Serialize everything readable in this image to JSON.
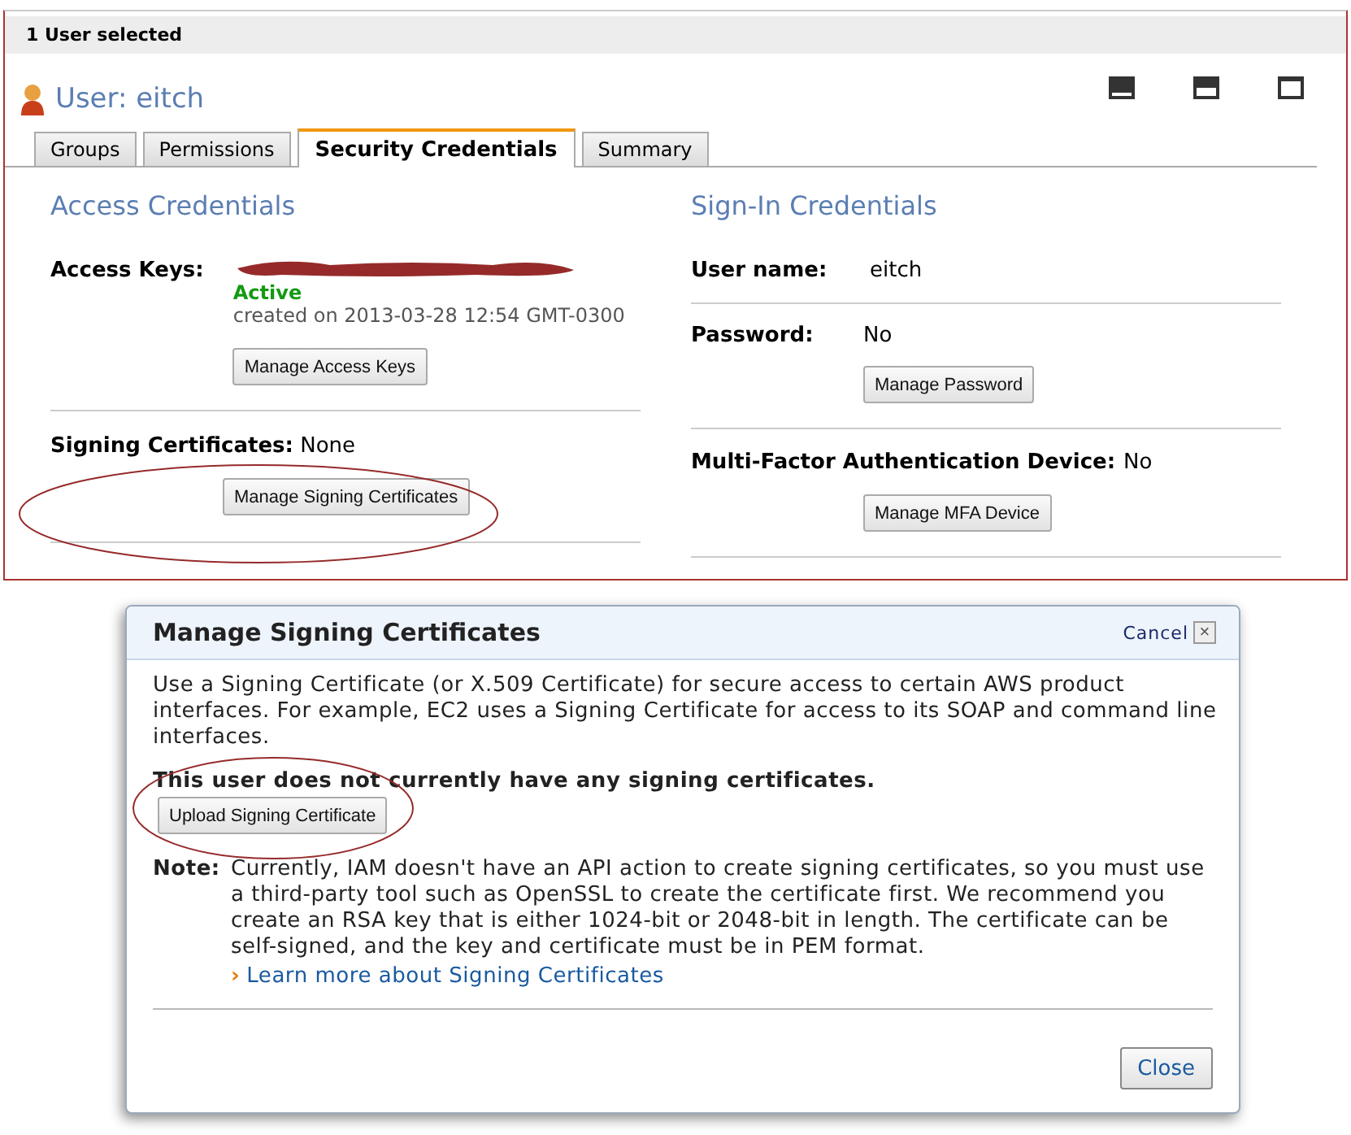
{
  "selection_bar": {
    "text": "1 User selected"
  },
  "user": {
    "label": "User:",
    "name": "eitch"
  },
  "tabs": [
    {
      "label": "Groups",
      "selected": false
    },
    {
      "label": "Permissions",
      "selected": false
    },
    {
      "label": "Security Credentials",
      "selected": true
    },
    {
      "label": "Summary",
      "selected": false
    }
  ],
  "access_credentials": {
    "title": "Access Credentials",
    "access_keys": {
      "label": "Access Keys:",
      "status": "Active",
      "created": "created on 2013-03-28 12:54 GMT-0300",
      "button": "Manage Access Keys"
    },
    "signing_certificates": {
      "label": "Signing Certificates:",
      "value": "None",
      "button": "Manage Signing Certificates"
    }
  },
  "sign_in_credentials": {
    "title": "Sign-In Credentials",
    "user_name": {
      "label": "User name:",
      "value": "eitch"
    },
    "password": {
      "label": "Password:",
      "value": "No",
      "button": "Manage Password"
    },
    "mfa": {
      "label": "Multi-Factor Authentication Device:",
      "value": "No",
      "button": "Manage MFA Device"
    }
  },
  "dialog": {
    "title": "Manage Signing Certificates",
    "cancel": "Cancel",
    "close_glyph": "×",
    "intro": "Use a Signing Certificate (or X.509 Certificate) for secure access to certain AWS product interfaces. For example, EC2 uses a Signing Certificate for access to its SOAP and command line interfaces.",
    "empty_message": "This user does not currently have any signing certificates.",
    "upload_button": "Upload Signing Certificate",
    "note_label": "Note:",
    "note": "Currently, IAM doesn't have an API action to create signing certificates, so you must use a third-party tool such as OpenSSL to create the certificate first. We recommend you create an RSA key that is either 1024-bit or 2048-bit in length. The certificate can be self-signed, and the key and certificate must be in PEM format.",
    "link_glyph": "›",
    "link": "Learn more about Signing Certificates",
    "close_button": "Close"
  }
}
